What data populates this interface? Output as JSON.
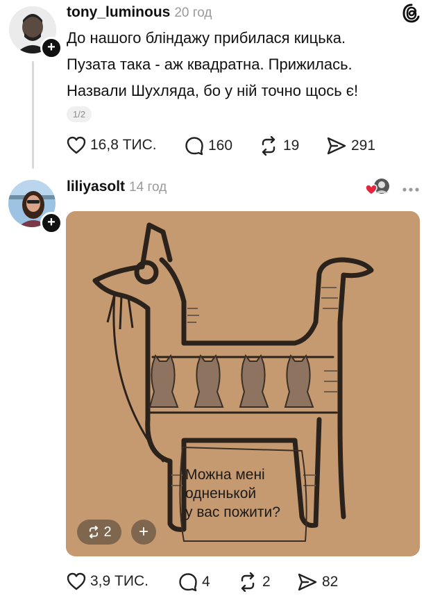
{
  "post1": {
    "username": "tony_luminous",
    "time": "20 год",
    "lines": [
      "До нашого бліндажу прибилася кицька.",
      "Пузата така - аж квадратна. Прижилась.",
      "Назвали Шухляда, бо у ній точно щось є!"
    ],
    "page_indicator": "1/2",
    "likes": "16,8 ТИС.",
    "comments": "160",
    "reposts": "19",
    "shares": "291"
  },
  "post2": {
    "username": "liliyasolt",
    "time": "14 год",
    "image": {
      "speech_lines": [
        "Можна мені",
        "одненькой",
        "у вас пожити?"
      ],
      "repost_count": "2",
      "add_label": "+"
    },
    "likes": "3,9 ТИС.",
    "comments": "4",
    "reposts": "2",
    "shares": "82"
  },
  "icons": {
    "threads_logo": "threads-logo-icon",
    "like": "heart-icon",
    "comment": "comment-bubble-icon",
    "repost": "repost-icon",
    "share": "send-icon",
    "more": "more-dots-icon"
  },
  "colors": {
    "image_background": "#c69a72",
    "heart_red": "#e8233c",
    "muted_text": "#9a9a9a"
  }
}
